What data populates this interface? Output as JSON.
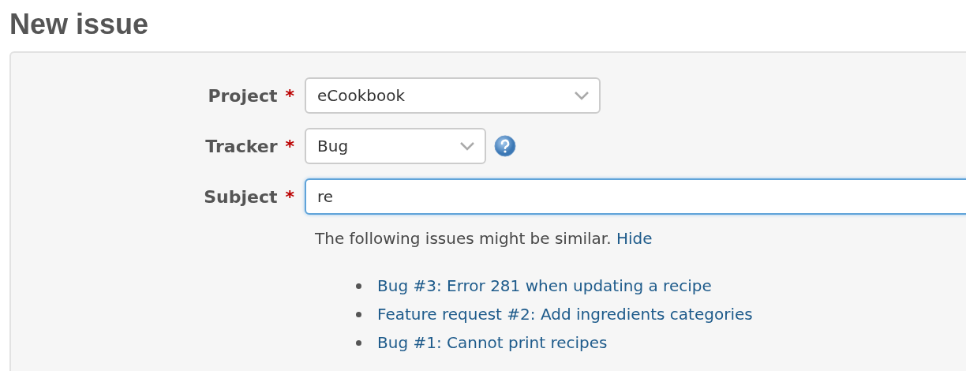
{
  "page_title": "New issue",
  "fields": [
    {
      "kind": "select",
      "label": "Project",
      "required_mark": "*",
      "value": "eCookbook",
      "help": false
    },
    {
      "kind": "select",
      "label": "Tracker",
      "required_mark": "*",
      "value": "Bug",
      "help": true
    },
    {
      "kind": "text",
      "label": "Subject",
      "required_mark": "*",
      "value": "re",
      "help": false,
      "focused": true
    }
  ],
  "similar": {
    "message": "The following issues might be similar.",
    "hide_link": "Hide",
    "issues": [
      {
        "text": "Bug #3: Error 281 when updating a recipe"
      },
      {
        "text": "Feature request #2: Add ingredients categories"
      },
      {
        "text": "Bug #1: Cannot print recipes"
      }
    ]
  }
}
